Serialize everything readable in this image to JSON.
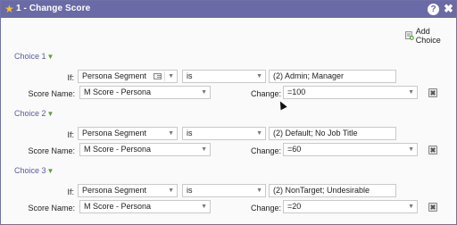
{
  "window": {
    "title": "1 - Change Score",
    "help_glyph": "?",
    "close_glyph": "✖",
    "star_glyph": "★"
  },
  "toolbar": {
    "add_choice_label": "Add Choice"
  },
  "labels": {
    "if": "If:",
    "score_name": "Score Name:",
    "change": "Change:"
  },
  "choices": [
    {
      "title": "Choice 1",
      "field": "Persona Segment",
      "operator": "is",
      "value": "(2) Admin; Manager",
      "score_name": "M Score - Persona",
      "change": "=100"
    },
    {
      "title": "Choice 2",
      "field": "Persona Segment",
      "operator": "is",
      "value": "(2) Default; No Job Title",
      "score_name": "M Score - Persona",
      "change": "=60"
    },
    {
      "title": "Choice 3",
      "field": "Persona Segment",
      "operator": "is",
      "value": "(2) NonTarget; Undesirable",
      "score_name": "M Score - Persona",
      "change": "=20"
    }
  ],
  "colors": {
    "titlebar": "#6a6aa6",
    "choice_header": "#5a5aa6",
    "accent_green": "#58a039",
    "star": "#f1c232"
  },
  "icons": {
    "title": "star-icon",
    "help": "help-icon",
    "close": "close-icon",
    "add": "add-choice-icon",
    "delete": "delete-icon",
    "field_list": "list-icon",
    "dropdown": "chevron-down-icon"
  }
}
